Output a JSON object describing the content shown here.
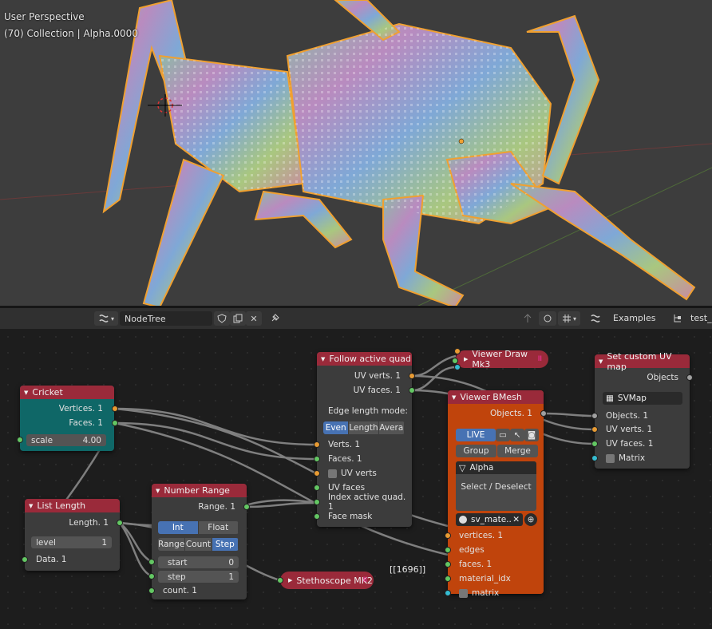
{
  "viewport": {
    "perspective": "User Perspective",
    "collection": "(70) Collection | Alpha.0000"
  },
  "header": {
    "tree_name": "NodeTree",
    "examples": "Examples",
    "trailing": "test_"
  },
  "nodes": {
    "cricket": {
      "title": "Cricket",
      "vertices": "Vertices. 1",
      "faces": "Faces. 1",
      "scale_label": "scale",
      "scale_value": "4.00"
    },
    "list_length": {
      "title": "List Length",
      "length": "Length. 1",
      "level_label": "level",
      "level_value": "1",
      "data": "Data. 1"
    },
    "number_range": {
      "title": "Number Range",
      "range": "Range. 1",
      "int": "Int",
      "float": "Float",
      "mode_range": "Range",
      "mode_count": "Count",
      "mode_step": "Step",
      "start_label": "start",
      "start_value": "0",
      "step_label": "step",
      "step_value": "1",
      "count": "count. 1"
    },
    "follow": {
      "title": "Follow active quad",
      "uv_verts": "UV verts. 1",
      "uv_faces": "UV faces. 1",
      "edge_mode": "Edge length mode:",
      "even": "Even",
      "length": "Length",
      "avera": "Avera",
      "verts": "Verts. 1",
      "faces": "Faces. 1",
      "in_uv_verts": "UV verts",
      "in_uv_faces": "UV faces",
      "index_active": "Index active quad. 1",
      "face_mask": "Face mask"
    },
    "viewer_draw": {
      "title": "Viewer Draw Mk3"
    },
    "viewer_bmesh": {
      "title": "Viewer BMesh",
      "objects": "Objects. 1",
      "live": "LIVE",
      "group": "Group",
      "merge": "Merge",
      "object_name": "Alpha",
      "select_deselect": "Select / Deselect",
      "material": "sv_mate..",
      "vertices": "vertices. 1",
      "edges": "edges",
      "faces": "faces. 1",
      "material_idx": "material_idx",
      "matrix": "matrix"
    },
    "set_uv": {
      "title": "Set custom UV map",
      "objects_out": "Objects",
      "svmap": "SVMap",
      "objects": "Objects. 1",
      "uv_verts": "UV verts. 1",
      "uv_faces": "UV faces. 1",
      "matrix": "Matrix"
    },
    "stethoscope": {
      "title": "Stethoscope MK2",
      "readout": "[[1696]]"
    }
  },
  "colors": {
    "node_red": "#9a2a3a",
    "cricket_body": "#0f6767",
    "bmesh_body": "#c0440c",
    "selection": "#4772b3"
  }
}
